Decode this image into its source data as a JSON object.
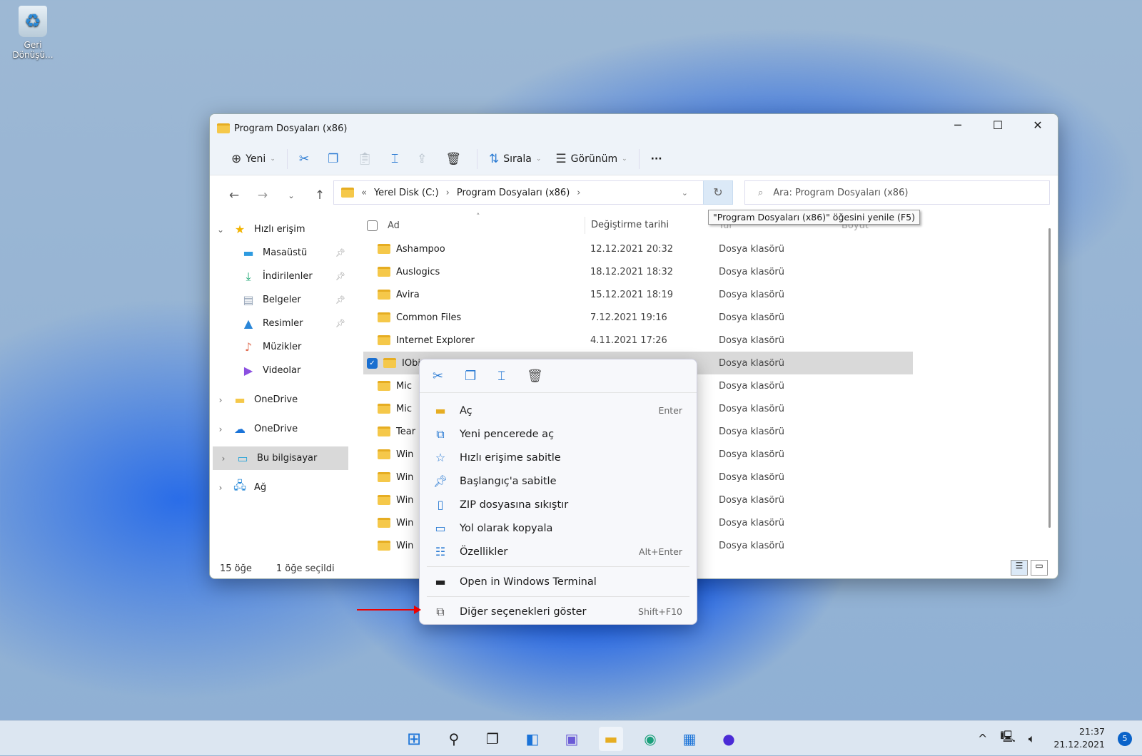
{
  "desktop": {
    "recycle_bin_label": "Geri Dönüşü..."
  },
  "window": {
    "title": "Program Dosyaları (x86)",
    "minimize": "─",
    "maximize": "☐",
    "close": "✕"
  },
  "toolbar": {
    "new_label": "Yeni",
    "sort_label": "Sırala",
    "view_label": "Görünüm",
    "more_label": "···"
  },
  "address": {
    "overflow": "«",
    "crumbs": [
      "Yerel Disk (C:)",
      "Program Dosyaları (x86)"
    ],
    "search_placeholder": "Ara: Program Dosyaları (x86)",
    "refresh_tooltip": "\"Program Dosyaları (x86)\" öğesini yenile (F5)"
  },
  "sidebar": {
    "items": [
      {
        "label": "Hızlı erişim",
        "icon": "star-icon",
        "color": "#f2b300"
      },
      {
        "label": "Masaüstü",
        "icon": "desktop-icon",
        "color": "#2e9be0",
        "pinned": true
      },
      {
        "label": "İndirilenler",
        "icon": "download-icon",
        "color": "#1ba672",
        "pinned": true
      },
      {
        "label": "Belgeler",
        "icon": "documents-icon",
        "color": "#9aa8bb",
        "pinned": true
      },
      {
        "label": "Resimler",
        "icon": "pictures-icon",
        "color": "#2a86d8",
        "pinned": true
      },
      {
        "label": "Müzikler",
        "icon": "music-icon",
        "color": "#e06b4f"
      },
      {
        "label": "Videolar",
        "icon": "videos-icon",
        "color": "#8b4fe0"
      },
      {
        "label": "OneDrive",
        "icon": "folder-icon",
        "color": "#f5c84a"
      },
      {
        "label": "OneDrive",
        "icon": "cloud-icon",
        "color": "#1a73d8"
      },
      {
        "label": "Bu bilgisayar",
        "icon": "computer-icon",
        "color": "#27a4d8"
      },
      {
        "label": "Ağ",
        "icon": "network-icon",
        "color": "#2a8ad8"
      }
    ]
  },
  "columns": {
    "name": "Ad",
    "modified": "Değiştirme tarihi",
    "type": "Tür",
    "size": "Boyut"
  },
  "files": [
    {
      "name": "Ashampoo",
      "modified": "12.12.2021 20:32",
      "type": "Dosya klasörü"
    },
    {
      "name": "Auslogics",
      "modified": "18.12.2021 18:32",
      "type": "Dosya klasörü"
    },
    {
      "name": "Avira",
      "modified": "15.12.2021 18:19",
      "type": "Dosya klasörü"
    },
    {
      "name": "Common Files",
      "modified": "7.12.2021 19:16",
      "type": "Dosya klasörü"
    },
    {
      "name": "Internet Explorer",
      "modified": "4.11.2021 17:26",
      "type": "Dosya klasörü"
    },
    {
      "name": "IObi",
      "modified": "",
      "type": "Dosya klasörü",
      "selected": true
    },
    {
      "name": "Mic",
      "modified": "",
      "type": "Dosya klasörü"
    },
    {
      "name": "Mic",
      "modified": "",
      "type": "Dosya klasörü"
    },
    {
      "name": "Tear",
      "modified": "",
      "type": "Dosya klasörü"
    },
    {
      "name": "Win",
      "modified": "",
      "type": "Dosya klasörü"
    },
    {
      "name": "Win",
      "modified": "",
      "type": "Dosya klasörü"
    },
    {
      "name": "Win",
      "modified": "",
      "type": "Dosya klasörü"
    },
    {
      "name": "Win",
      "modified": "",
      "type": "Dosya klasörü"
    },
    {
      "name": "Win",
      "modified": "",
      "type": "Dosya klasörü"
    }
  ],
  "status": {
    "count": "15 öğe",
    "selected": "1 öğe seçildi"
  },
  "context_menu": {
    "items": [
      {
        "label": "Aç",
        "shortcut": "Enter",
        "icon": "folder-open-icon"
      },
      {
        "label": "Yeni pencerede aç",
        "icon": "open-new-window-icon"
      },
      {
        "label": "Hızlı erişime sabitle",
        "icon": "star-icon"
      },
      {
        "label": "Başlangıç'a sabitle",
        "icon": "pin-icon"
      },
      {
        "label": "ZIP dosyasına sıkıştır",
        "icon": "zip-icon"
      },
      {
        "label": "Yol olarak kopyala",
        "icon": "copy-path-icon"
      },
      {
        "label": "Özellikler",
        "shortcut": "Alt+Enter",
        "icon": "properties-icon"
      }
    ],
    "terminal": "Open in Windows Terminal",
    "more": {
      "label": "Diğer seçenekleri göster",
      "shortcut": "Shift+F10"
    }
  },
  "taskbar": {
    "time": "21:37",
    "date": "21.12.2021",
    "notifications": "5"
  }
}
